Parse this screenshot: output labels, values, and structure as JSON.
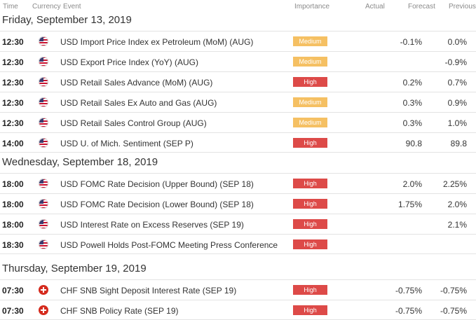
{
  "header": {
    "time": "Time",
    "currency": "Currency",
    "event": "Event",
    "importance": "Importance",
    "actual": "Actual",
    "forecast": "Forecast",
    "previous": "Previous"
  },
  "colors": {
    "medium": "#f5c063",
    "high": "#dd4a48"
  },
  "days": [
    {
      "label": "Friday, September 13, 2019",
      "events": [
        {
          "time": "12:30",
          "flag": "us-flag-icon",
          "event": "USD Import Price Index ex Petroleum (MoM) (AUG)",
          "importance": "Medium",
          "actual": "",
          "forecast": "-0.1%",
          "previous": "0.0%"
        },
        {
          "time": "12:30",
          "flag": "us-flag-icon",
          "event": "USD Export Price Index (YoY) (AUG)",
          "importance": "Medium",
          "actual": "",
          "forecast": "",
          "previous": "-0.9%"
        },
        {
          "time": "12:30",
          "flag": "us-flag-icon",
          "event": "USD Retail Sales Advance (MoM) (AUG)",
          "importance": "High",
          "actual": "",
          "forecast": "0.2%",
          "previous": "0.7%"
        },
        {
          "time": "12:30",
          "flag": "us-flag-icon",
          "event": "USD Retail Sales Ex Auto and Gas (AUG)",
          "importance": "Medium",
          "actual": "",
          "forecast": "0.3%",
          "previous": "0.9%"
        },
        {
          "time": "12:30",
          "flag": "us-flag-icon",
          "event": "USD Retail Sales Control Group (AUG)",
          "importance": "Medium",
          "actual": "",
          "forecast": "0.3%",
          "previous": "1.0%"
        },
        {
          "time": "14:00",
          "flag": "us-flag-icon",
          "event": "USD U. of Mich. Sentiment (SEP P)",
          "importance": "High",
          "actual": "",
          "forecast": "90.8",
          "previous": "89.8"
        }
      ]
    },
    {
      "label": "Wednesday, September 18, 2019",
      "events": [
        {
          "time": "18:00",
          "flag": "us-flag-icon",
          "event": "USD FOMC Rate Decision (Upper Bound) (SEP 18)",
          "importance": "High",
          "actual": "",
          "forecast": "2.0%",
          "previous": "2.25%"
        },
        {
          "time": "18:00",
          "flag": "us-flag-icon",
          "event": "USD FOMC Rate Decision (Lower Bound) (SEP 18)",
          "importance": "High",
          "actual": "",
          "forecast": "1.75%",
          "previous": "2.0%"
        },
        {
          "time": "18:00",
          "flag": "us-flag-icon",
          "event": "USD Interest Rate on Excess Reserves (SEP 19)",
          "importance": "High",
          "actual": "",
          "forecast": "",
          "previous": "2.1%"
        },
        {
          "time": "18:30",
          "flag": "us-flag-icon",
          "event": "USD Powell Holds Post-FOMC Meeting Press Conference",
          "importance": "High",
          "actual": "",
          "forecast": "",
          "previous": ""
        }
      ]
    },
    {
      "label": "Thursday, September 19, 2019",
      "events": [
        {
          "time": "07:30",
          "flag": "ch-flag-icon",
          "event": "CHF SNB Sight Deposit Interest Rate (SEP 19)",
          "importance": "High",
          "actual": "",
          "forecast": "-0.75%",
          "previous": "-0.75%"
        },
        {
          "time": "07:30",
          "flag": "ch-flag-icon",
          "event": "CHF SNB Policy Rate (SEP 19)",
          "importance": "High",
          "actual": "",
          "forecast": "-0.75%",
          "previous": "-0.75%"
        }
      ]
    }
  ]
}
